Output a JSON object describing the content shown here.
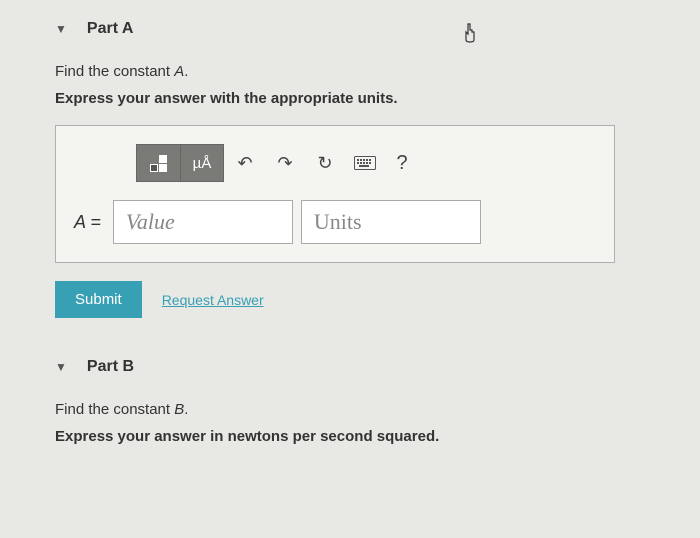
{
  "partA": {
    "title": "Part A",
    "prompt_pre": "Find the constant ",
    "prompt_var": "A",
    "prompt_post": ".",
    "instruction": "Express your answer with the appropriate units.",
    "toolbar": {
      "units_label": "µÅ",
      "help": "?"
    },
    "input": {
      "label": "A =",
      "value_placeholder": "Value",
      "units_placeholder": "Units"
    },
    "submit": "Submit",
    "request": "Request Answer"
  },
  "partB": {
    "title": "Part B",
    "prompt_pre": "Find the constant ",
    "prompt_var": "B",
    "prompt_post": ".",
    "instruction": "Express your answer in newtons per second squared."
  }
}
